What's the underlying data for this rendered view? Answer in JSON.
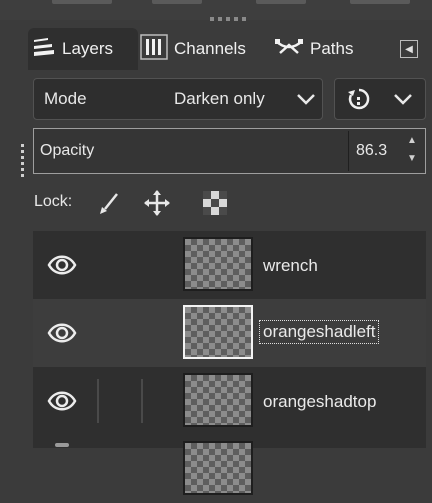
{
  "tabs": {
    "layers_label": "Layers",
    "channels_label": "Channels",
    "paths_label": "Paths"
  },
  "mode": {
    "label": "Mode",
    "value": "Darken only"
  },
  "opacity": {
    "label": "Opacity",
    "value": "86.3"
  },
  "lock": {
    "label": "Lock:"
  },
  "layers": [
    {
      "name": "wrench",
      "selected": false
    },
    {
      "name": "orangeshadleft",
      "selected": true
    },
    {
      "name": "orangeshadtop",
      "selected": false
    }
  ],
  "colors": {
    "background": "#3b3b3b",
    "list_background": "#2f2f2f",
    "selected_row": "#3d3d3d",
    "text": "#e8e8e8"
  }
}
